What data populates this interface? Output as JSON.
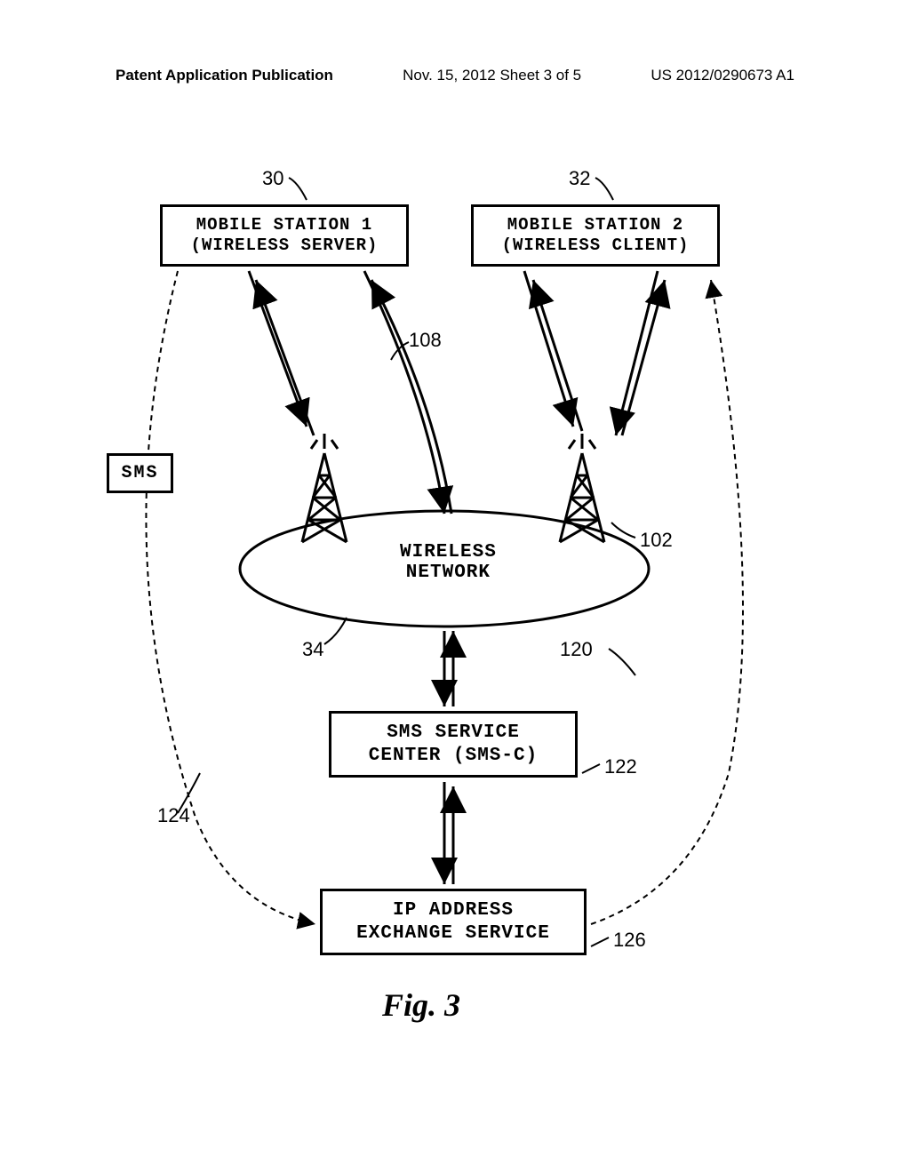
{
  "header": {
    "left": "Patent Application Publication",
    "center": "Nov. 15, 2012  Sheet 3 of 5",
    "right": "US 2012/0290673 A1"
  },
  "boxes": {
    "mobile1": {
      "line1": "MOBILE STATION 1",
      "line2": "(WIRELESS SERVER)"
    },
    "mobile2": {
      "line1": "MOBILE STATION 2",
      "line2": "(WIRELESS CLIENT)"
    },
    "sms": "SMS",
    "wireless": {
      "line1": "WIRELESS",
      "line2": "NETWORK"
    },
    "smsc": {
      "line1": "SMS SERVICE",
      "line2": "CENTER (SMS-C)"
    },
    "ip": {
      "line1": "IP ADDRESS",
      "line2": "EXCHANGE SERVICE"
    }
  },
  "refs": {
    "r30": "30",
    "r32": "32",
    "r108": "108",
    "r102": "102",
    "r34": "34",
    "r120": "120",
    "r122": "122",
    "r124": "124",
    "r126": "126"
  },
  "figure": "Fig.  3"
}
